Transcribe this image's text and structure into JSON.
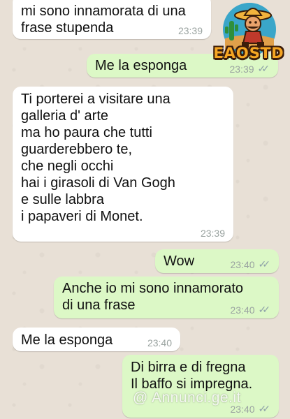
{
  "messages": [
    {
      "text": "mi sono innamorata di una\nfrase stupenda",
      "time": "23:39",
      "direction": "incoming"
    },
    {
      "text": "Me la esponga",
      "time": "23:39",
      "direction": "outgoing",
      "ticks": "read"
    },
    {
      "text": "Ti porterei a visitare una\ngalleria d' arte\nma ho paura che tutti\nguarderebbero te,\nche negli occhi\nhai i girasoli di Van Gogh\ne sulle labbra\ni papaveri di Monet.",
      "time": "23:39",
      "direction": "incoming"
    },
    {
      "text": "Wow",
      "time": "23:40",
      "direction": "outgoing",
      "ticks": "read"
    },
    {
      "text": "Anche io mi sono innamorato\ndi una frase",
      "time": "23:40",
      "direction": "outgoing",
      "ticks": "read"
    },
    {
      "text": "Me la esponga",
      "time": "23:40",
      "direction": "incoming"
    },
    {
      "text": "Di birra e di fregna\nIl baffo si impregna.",
      "time": "23:40",
      "direction": "outgoing",
      "ticks": "read"
    }
  ],
  "logo": {
    "text": "EAOSTD",
    "icon": "cartoon-cowboy-logo"
  },
  "watermark": {
    "text": "@ Annunci.ge.it"
  },
  "colors": {
    "incoming_bubble": "#ffffff",
    "outgoing_bubble": "#dcf8c6",
    "background": "#e8e0d6",
    "tick": "#8fa3a8"
  }
}
